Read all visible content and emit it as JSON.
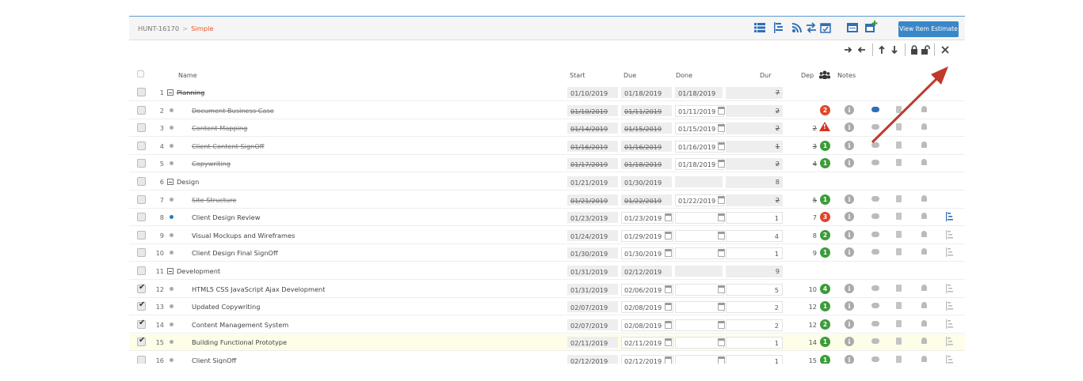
{
  "breadcrumb": {
    "id": "HUNT-16170",
    "separator": ">",
    "current": "Simple"
  },
  "toolbar": {
    "view_estimate_label": "View Item Estimate"
  },
  "columns": {
    "name": "Name",
    "start": "Start",
    "due": "Due",
    "done": "Done",
    "dur": "Dur",
    "dep": "Dep",
    "notes": "Notes"
  },
  "colors": {
    "accent": "#3a87c8",
    "breadcrumb_current": "#e4572e",
    "badge_green": "#3c9c3a",
    "badge_red": "#e0452b",
    "highlight_row": "#fdfde8",
    "arrow": "#c0392b"
  },
  "rows": [
    {
      "num": "1",
      "kind": "group",
      "name": "Planning",
      "start": "01/10/2019",
      "due": "01/18/2019",
      "done": "01/18/2019",
      "dur": "7",
      "dep": "",
      "badge": "",
      "checked": false,
      "complete": true,
      "dot": ""
    },
    {
      "num": "2",
      "kind": "task",
      "name": "Document Business Case",
      "start": "01/10/2019",
      "due": "01/11/2019",
      "done": "01/11/2019",
      "dur": "2",
      "dep": "",
      "badge": "2",
      "badgeColor": "red",
      "checked": false,
      "complete": true,
      "dot": "gray",
      "chat": "active"
    },
    {
      "num": "3",
      "kind": "task",
      "name": "Content Mapping",
      "start": "01/14/2019",
      "due": "01/15/2019",
      "done": "01/15/2019",
      "dur": "2",
      "dep": "2",
      "badge": "!",
      "badgeColor": "warn",
      "checked": false,
      "complete": true,
      "dot": "gray"
    },
    {
      "num": "4",
      "kind": "task",
      "name": "Client Content SignOff",
      "start": "01/16/2019",
      "due": "01/16/2019",
      "done": "01/16/2019",
      "dur": "1",
      "dep": "3",
      "badge": "1",
      "badgeColor": "green",
      "checked": false,
      "complete": true,
      "dot": "gray"
    },
    {
      "num": "5",
      "kind": "task",
      "name": "Copywriting",
      "start": "01/17/2019",
      "due": "01/18/2019",
      "done": "01/18/2019",
      "dur": "2",
      "dep": "4",
      "badge": "1",
      "badgeColor": "green",
      "checked": false,
      "complete": true,
      "dot": "gray"
    },
    {
      "num": "6",
      "kind": "group",
      "name": "Design",
      "start": "01/21/2019",
      "due": "01/30/2019",
      "done": "",
      "dur": "8",
      "dep": "",
      "badge": "",
      "checked": false,
      "complete": false,
      "dot": ""
    },
    {
      "num": "7",
      "kind": "task",
      "name": "Site Structure",
      "start": "01/21/2019",
      "due": "01/22/2019",
      "done": "01/22/2019",
      "dur": "2",
      "dep": "5",
      "badge": "1",
      "badgeColor": "green",
      "checked": false,
      "complete": true,
      "dot": "gray"
    },
    {
      "num": "8",
      "kind": "task",
      "name": "Client Design Review",
      "start": "01/23/2019",
      "due": "01/23/2019",
      "done": "",
      "dur": "1",
      "dep": "7",
      "badge": "3",
      "badgeColor": "red",
      "checked": false,
      "complete": false,
      "dot": "blue"
    },
    {
      "num": "9",
      "kind": "task",
      "name": "Visual Mockups and Wireframes",
      "start": "01/24/2019",
      "due": "01/29/2019",
      "done": "",
      "dur": "4",
      "dep": "8",
      "badge": "2",
      "badgeColor": "green",
      "checked": false,
      "complete": false,
      "dot": "gray"
    },
    {
      "num": "10",
      "kind": "task",
      "name": "Client Design Final SignOff",
      "start": "01/30/2019",
      "due": "01/30/2019",
      "done": "",
      "dur": "1",
      "dep": "9",
      "badge": "1",
      "badgeColor": "green",
      "checked": false,
      "complete": false,
      "dot": "gray"
    },
    {
      "num": "11",
      "kind": "group",
      "name": "Development",
      "start": "01/31/2019",
      "due": "02/12/2019",
      "done": "",
      "dur": "9",
      "dep": "",
      "badge": "",
      "checked": false,
      "complete": false,
      "dot": ""
    },
    {
      "num": "12",
      "kind": "task",
      "name": "HTML5  CSS  JavaScript  Ajax Development",
      "start": "01/31/2019",
      "due": "02/06/2019",
      "done": "",
      "dur": "5",
      "dep": "10",
      "badge": "4",
      "badgeColor": "green",
      "checked": true,
      "complete": false,
      "dot": "gray"
    },
    {
      "num": "13",
      "kind": "task",
      "name": "Updated Copywriting",
      "start": "02/07/2019",
      "due": "02/08/2019",
      "done": "",
      "dur": "2",
      "dep": "12",
      "badge": "1",
      "badgeColor": "green",
      "checked": true,
      "complete": false,
      "dot": "gray"
    },
    {
      "num": "14",
      "kind": "task",
      "name": "Content Management System",
      "start": "02/07/2019",
      "due": "02/08/2019",
      "done": "",
      "dur": "2",
      "dep": "12",
      "badge": "2",
      "badgeColor": "green",
      "checked": true,
      "complete": false,
      "dot": "gray"
    },
    {
      "num": "15",
      "kind": "task",
      "name": "Building Functional Prototype",
      "start": "02/11/2019",
      "due": "02/11/2019",
      "done": "",
      "dur": "1",
      "dep": "14",
      "badge": "1",
      "badgeColor": "green",
      "checked": true,
      "complete": false,
      "dot": "gray",
      "highlight": true
    },
    {
      "num": "16",
      "kind": "task",
      "name": "Client SignOff",
      "start": "02/12/2019",
      "due": "02/12/2019",
      "done": "",
      "dur": "1",
      "dep": "15",
      "badge": "1",
      "badgeColor": "green",
      "checked": false,
      "complete": false,
      "dot": "gray"
    }
  ]
}
